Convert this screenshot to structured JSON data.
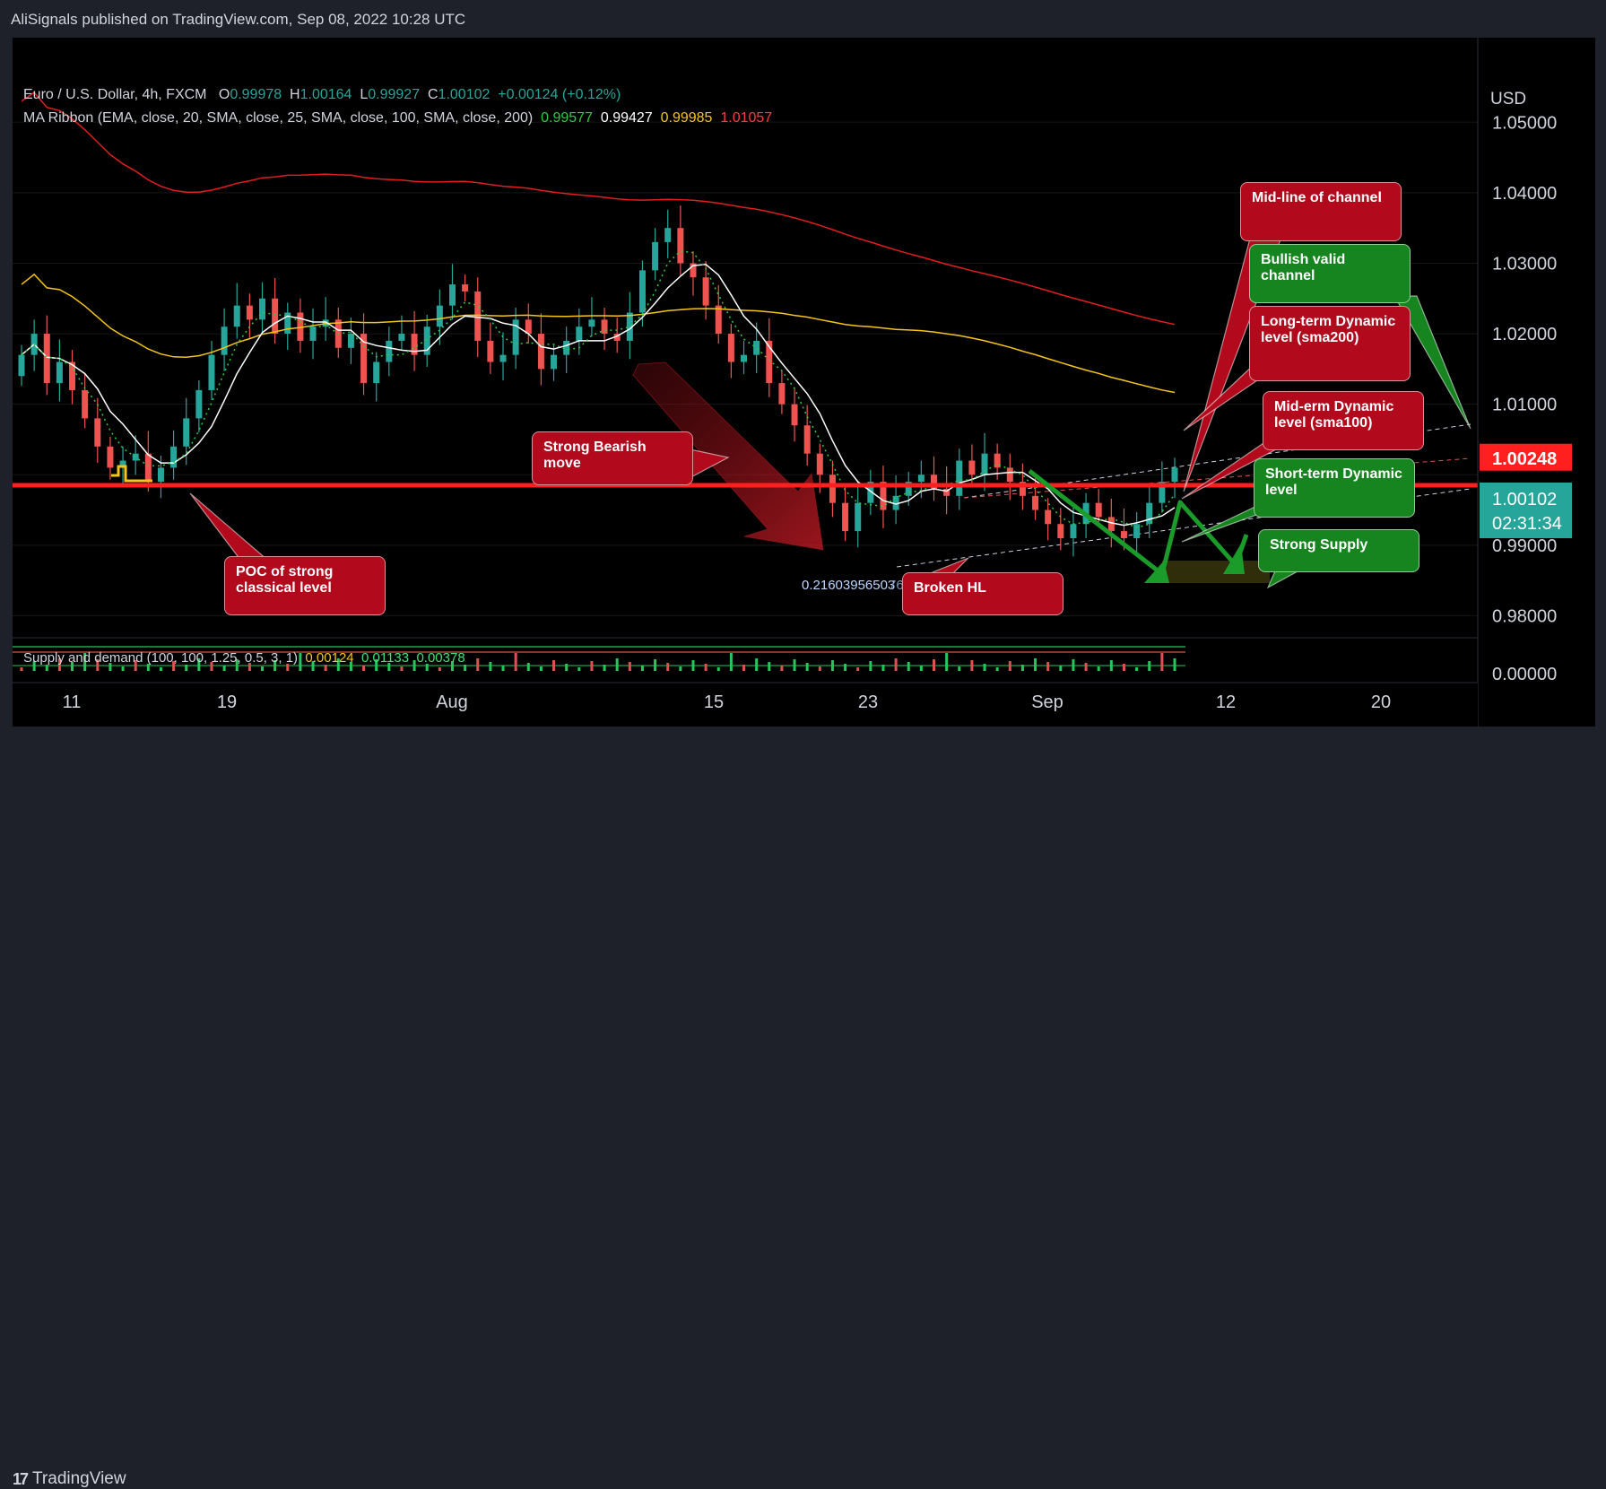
{
  "header": {
    "published": "AliSignals published on TradingView.com, Sep 08, 2022 10:28 UTC"
  },
  "footer": {
    "brand": "TradingView"
  },
  "legend": {
    "symbol": "Euro / U.S. Dollar, 4h, FXCM",
    "o_label": "O",
    "o": "0.99978",
    "h_label": "H",
    "h": "1.00164",
    "l_label": "L",
    "l": "0.99927",
    "c_label": "C",
    "c": "1.00102",
    "change": "+0.00124 (+0.12%)",
    "ma_title": "MA Ribbon (EMA, close, 20, SMA, close, 25, SMA, close, 100, SMA, close, 200)",
    "ma_values": [
      "0.99577",
      "0.99427",
      "0.99985",
      "1.01057"
    ]
  },
  "sd_legend": {
    "title": "Supply and demand (100, 100, 1.25, 0.5, 3, 1)",
    "v1": "0.00124",
    "v2": "0.01133",
    "v3": "0.00378"
  },
  "price_axis": {
    "currency": "USD",
    "current_price": "1.00102",
    "countdown": "02:31:34",
    "red_level": "1.00248"
  },
  "fib_text": "0.21603956503",
  "fib_text_faded": "76101",
  "annotations": {
    "midline": "Mid-line of channel",
    "bullish": "Bullish valid channel",
    "longterm": "Long-term Dynamic level (sma200)",
    "midterm": "Mid-erm Dynamic level (sma100)",
    "shortterm": "Short-term Dynamic level",
    "supply": "Strong Supply",
    "bearish": "Strong Bearish move",
    "poc": "POC of strong classical level",
    "broken": "Broken HL"
  },
  "colors": {
    "bull": "#26a69a",
    "bear": "#ef5350",
    "ema20": "#2ecc40",
    "sma25": "#ffffff",
    "sma100": "#f5c518",
    "sma200": "#e01e1e",
    "level": "#ff1f1f",
    "price_tag": "#26a69a"
  },
  "chart_data": {
    "type": "candlestick",
    "symbol": "EURUSD",
    "timeframe": "4h",
    "y_axis": {
      "ticks": [
        0.98,
        0.99,
        1.0,
        1.01,
        1.02,
        1.03,
        1.04,
        1.05
      ],
      "tick_labels": [
        "0.98000",
        "0.99000",
        "1.01000",
        "1.02000",
        "1.03000",
        "1.04000",
        "1.05000"
      ],
      "range": [
        0.977,
        1.062
      ]
    },
    "x_axis": {
      "tick_labels": [
        "11",
        "19",
        "Aug",
        "15",
        "23",
        "Sep",
        "12",
        "20"
      ]
    },
    "key_level": 1.0005,
    "red_level": 1.00248,
    "last_close": 1.00102,
    "closes": [
      1.017,
      1.02,
      1.013,
      1.016,
      1.012,
      1.008,
      1.004,
      1.001,
      1.002,
      1.003,
      0.999,
      1.001,
      1.004,
      1.008,
      1.012,
      1.017,
      1.021,
      1.024,
      1.022,
      1.025,
      1.02,
      1.023,
      1.019,
      1.021,
      1.022,
      1.018,
      1.02,
      1.013,
      1.016,
      1.019,
      1.02,
      1.017,
      1.021,
      1.024,
      1.027,
      1.026,
      1.019,
      1.016,
      1.017,
      1.022,
      1.02,
      1.015,
      1.017,
      1.019,
      1.021,
      1.022,
      1.02,
      1.019,
      1.023,
      1.029,
      1.033,
      1.035,
      1.03,
      1.028,
      1.024,
      1.02,
      1.016,
      1.017,
      1.019,
      1.013,
      1.01,
      1.007,
      1.003,
      1.0,
      0.996,
      0.992,
      0.996,
      0.999,
      0.995,
      0.997,
      0.999,
      1.0,
      0.998,
      0.997,
      1.002,
      1.0,
      1.003,
      1.001,
      0.999,
      0.997,
      0.995,
      0.993,
      0.991,
      0.993,
      0.996,
      0.994,
      0.992,
      0.991,
      0.993,
      0.996,
      0.999,
      1.001
    ]
  }
}
